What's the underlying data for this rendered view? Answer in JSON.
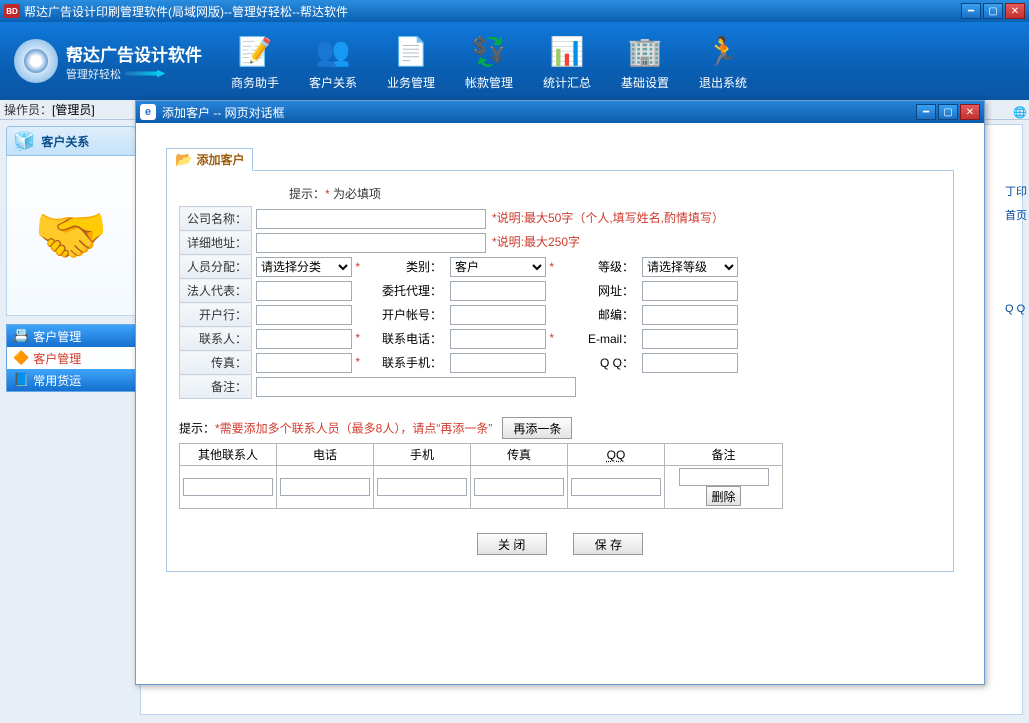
{
  "app": {
    "title": "帮达广告设计印刷管理软件(局域网版)--管理好轻松--帮达软件",
    "logoTitle": "帮达广告设计软件",
    "logoSub": "管理好轻松"
  },
  "toolbar": [
    {
      "id": "biz-helper",
      "label": "商务助手"
    },
    {
      "id": "crm",
      "label": "客户关系"
    },
    {
      "id": "biz-manage",
      "label": "业务管理"
    },
    {
      "id": "account",
      "label": "帐款管理"
    },
    {
      "id": "stats",
      "label": "统计汇总"
    },
    {
      "id": "settings",
      "label": "基础设置"
    },
    {
      "id": "exit",
      "label": "退出系统"
    }
  ],
  "status": {
    "operatorLabel": "操作员：",
    "operator": "[管理员]"
  },
  "side": {
    "header": "客户关系",
    "items": [
      {
        "label": "客户管理",
        "cls": "blue",
        "ico": "📇"
      },
      {
        "label": "客户管理",
        "cls": "white",
        "ico": "🔶"
      },
      {
        "label": "常用货运",
        "cls": "blue",
        "ico": "📘"
      }
    ]
  },
  "rtcol": {
    "print": "丁印",
    "home": "首页",
    "qq": "Q Q"
  },
  "dialog": {
    "title": "添加客户  --  网页对话框",
    "tab": "添加客户",
    "hint_pre": "提示：",
    "hint_mark": "*",
    "hint_post": " 为必填项",
    "labels": {
      "company": "公司名称：",
      "company_note": "*说明:最大50字（个人,填写姓名,酌情填写）",
      "address": "详细地址：",
      "address_note": "*说明:最大250字",
      "category": "人员分配：",
      "cat_ph": "请选择分类",
      "type": "类别：",
      "type_val": "客户",
      "grade": "等级：",
      "grade_ph": "请选择等级",
      "legal": "法人代表：",
      "agent": "委托代理：",
      "site": "网址：",
      "bank": "开户行：",
      "account": "开户帐号：",
      "zip": "邮编：",
      "contact": "联系人：",
      "phone": "联系电话：",
      "email": "E-mail：",
      "fax": "传真：",
      "mobile": "联系手机：",
      "qq": "Q  Q：",
      "remark": "备注："
    },
    "hint2_a": "提示：",
    "hint2_b": "*需要添加多个联系人员（最多8人），请点“",
    "hint2_c": "再添一条",
    "hint2_d": "”",
    "addBtn": "再添一条",
    "cols": {
      "other": "其他联系人",
      "tel": "电话",
      "mob": "手机",
      "fax": "传真",
      "qq": "QQ",
      "rem": "备注"
    },
    "delBtn": "删除",
    "closeBtn": "关 闭",
    "saveBtn": "保 存"
  }
}
